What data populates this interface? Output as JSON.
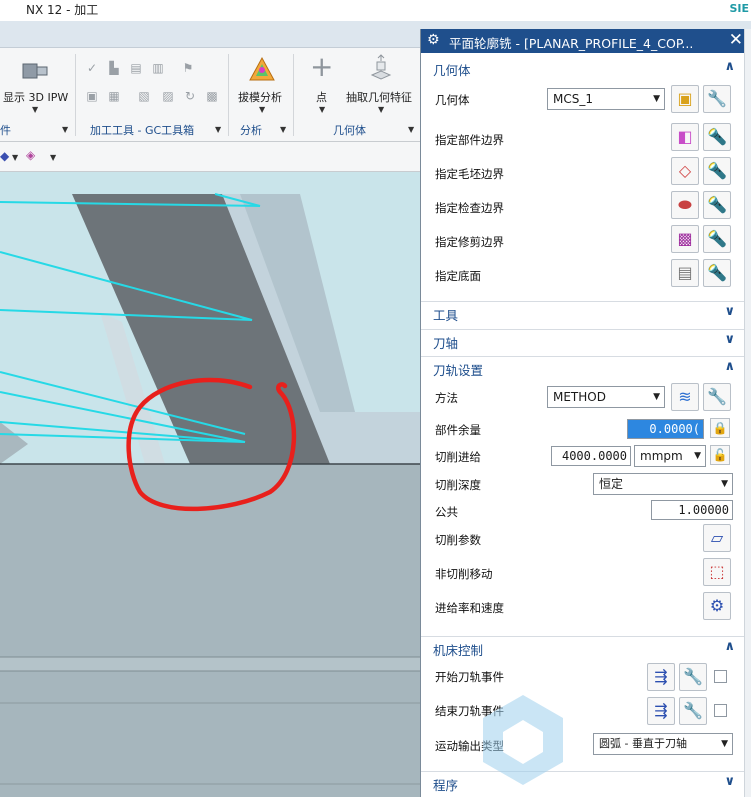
{
  "app": {
    "title": "NX 12 - 加工",
    "brand": "SIE"
  },
  "ribbon": {
    "show_ipw": "显示 3D IPW",
    "left_group_label": "件",
    "group_machining_tools": "加工工具 - GC工具箱",
    "group_analysis": "分析",
    "group_geometry": "几何体",
    "draft_analysis": "拔模分析",
    "point": "点",
    "extract_geometry": "抽取几何特征"
  },
  "dialog": {
    "title": "平面轮廓铣 - [PLANAR_PROFILE_4_COP...",
    "sections": {
      "geometry": "几何体",
      "tool": "工具",
      "tool_axis": "刀轴",
      "path_settings": "刀轨设置",
      "machine_control": "机床控制",
      "program": "程序"
    },
    "geometry": {
      "geometry_label": "几何体",
      "geometry_value": "MCS_1",
      "part_boundary": "指定部件边界",
      "blank_boundary": "指定毛坯边界",
      "check_boundary": "指定检查边界",
      "trim_boundary": "指定修剪边界",
      "floor": "指定底面"
    },
    "path": {
      "method_label": "方法",
      "method_value": "METHOD",
      "stock_label": "部件余量",
      "stock_value": "0.0000(",
      "feed_label": "切削进给",
      "feed_value": "4000.0000",
      "feed_unit": "mmpm",
      "depth_label": "切削深度",
      "depth_value": "恒定",
      "common_label": "公共",
      "common_value": "1.00000",
      "cut_params": "切削参数",
      "noncut_moves": "非切削移动",
      "feeds_speeds": "进给率和速度"
    },
    "machine": {
      "start_event": "开始刀轨事件",
      "end_event": "结束刀轨事件",
      "motion_output_label": "运动输出类型",
      "motion_output_value": "圆弧 - 垂直于刀轴"
    }
  },
  "colors": {
    "dialog_title_bg": "#1f4f8c",
    "section_text": "#1e4e8c",
    "viewport_bg": "#c9e4ea",
    "toolpath": "#26d9e6",
    "annotation": "#e8201c",
    "highlight_input": "#2d87e0"
  },
  "icons": {
    "title_gear": "gear-icon",
    "close": "close-icon"
  }
}
